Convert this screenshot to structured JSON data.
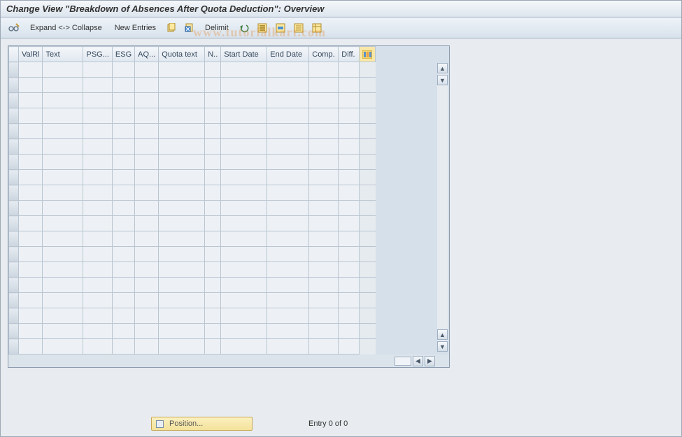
{
  "title": "Change View \"Breakdown of Absences After Quota Deduction\": Overview",
  "toolbar": {
    "expand_collapse": "Expand <-> Collapse",
    "new_entries": "New Entries",
    "delimit": "Delimit"
  },
  "columns": {
    "valrl": "ValRl",
    "text": "Text",
    "psg": "PSG...",
    "esg": "ESG",
    "aq": "AQ...",
    "quota_text": "Quota text",
    "n": "N..",
    "start_date": "Start Date",
    "end_date": "End Date",
    "comp": "Comp.",
    "diff": "Diff."
  },
  "footer": {
    "position": "Position...",
    "entry": "Entry 0 of 0"
  },
  "watermark": "www.tutorialkart.com"
}
